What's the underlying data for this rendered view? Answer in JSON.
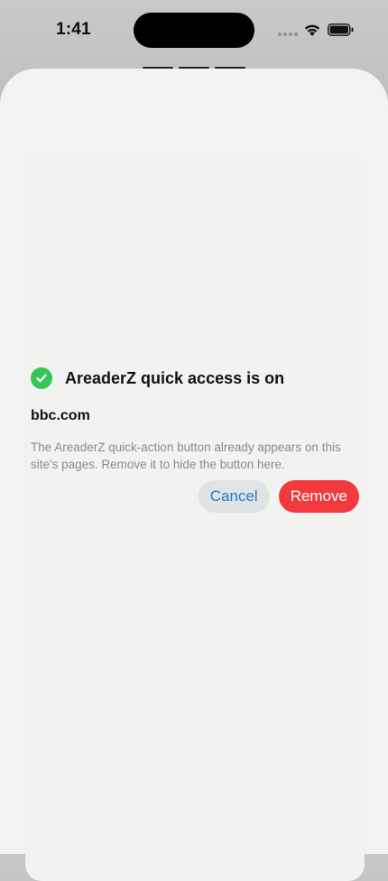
{
  "status_bar": {
    "time": "1:41"
  },
  "dialog": {
    "title": "AreaderZ quick access is on",
    "domain": "bbc.com",
    "description": "The AreaderZ quick-action button already appears on this site's pages. Remove it to hide the button here.",
    "cancel_label": "Cancel",
    "remove_label": "Remove",
    "icon": "checkmark-circle-icon"
  },
  "colors": {
    "success": "#34c659",
    "destructive": "#f23a3c",
    "link": "#1f7bd8",
    "cancel_background": "#e1e2e2",
    "sheet_background": "#f3f3f1"
  }
}
